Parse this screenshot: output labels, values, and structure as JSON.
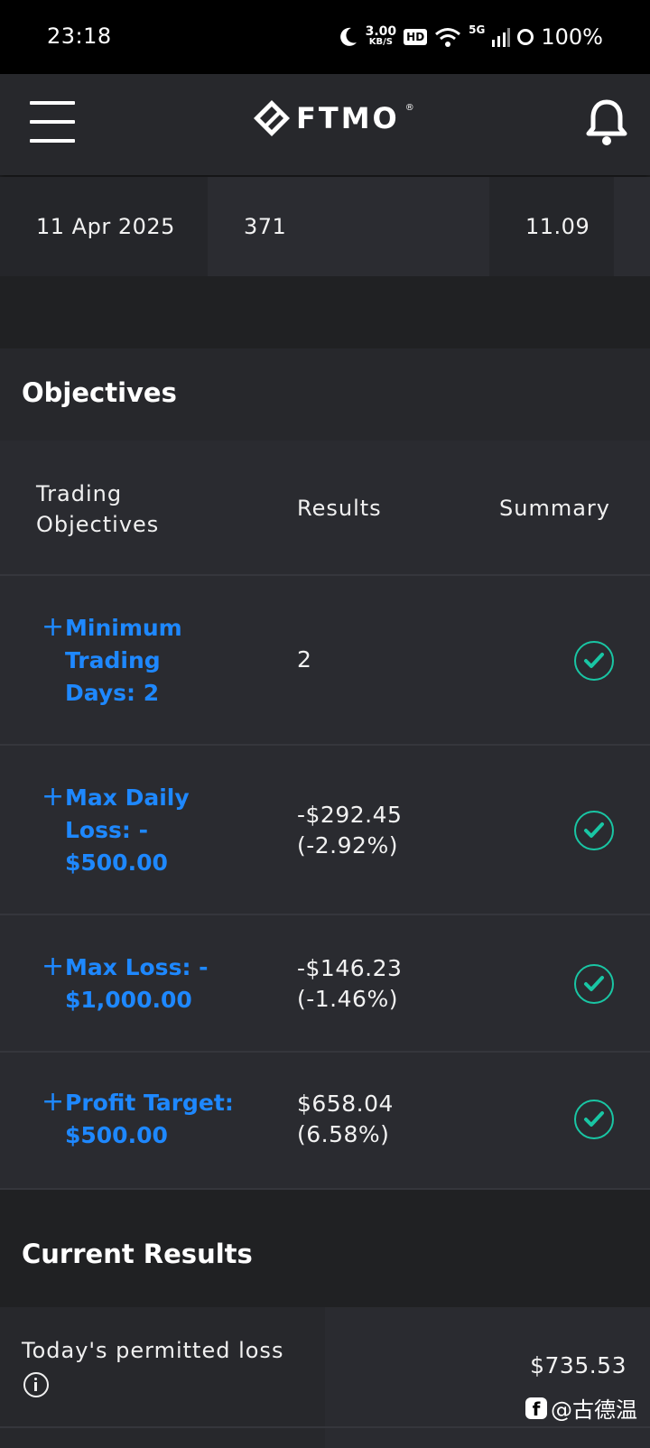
{
  "status_bar": {
    "time": "23:18",
    "net_speed": "3.00",
    "net_unit": "KB/S",
    "hd": "HD",
    "network": "5G",
    "battery": "100%"
  },
  "header": {
    "logo_text": "FTMO",
    "logo_reg": "®"
  },
  "previous_row": {
    "date": "11 Apr 2025",
    "col2": "371",
    "col3": "11.09"
  },
  "objectives": {
    "title": "Objectives",
    "headers": {
      "objective_line1": "Trading",
      "objective_line2": "Objectives",
      "results": "Results",
      "summary": "Summary"
    },
    "rows": [
      {
        "name_lines": [
          "Minimum",
          "Trading",
          "Days:  2"
        ],
        "result_lines": [
          "2"
        ],
        "status": "passed"
      },
      {
        "name_lines": [
          "Max Daily",
          "Loss:  -",
          "$500.00"
        ],
        "result_lines": [
          "-$292.45",
          "(-2.92%)"
        ],
        "status": "passed"
      },
      {
        "name_lines": [
          "Max Loss:  -",
          "$1,000.00"
        ],
        "result_lines": [
          "-$146.23",
          "(-1.46%)"
        ],
        "status": "passed"
      },
      {
        "name_lines": [
          "Profit Target:",
          "$500.00"
        ],
        "result_lines": [
          "$658.04",
          "(6.58%)"
        ],
        "status": "passed"
      }
    ]
  },
  "current_results": {
    "title": "Current Results",
    "rows": [
      {
        "label": "Today's permitted loss",
        "value": "$735.53"
      }
    ]
  },
  "watermark": {
    "text": "@古德温"
  },
  "colors": {
    "link_blue": "#1e88ff",
    "check_teal": "#19c6a4",
    "background": "#202123",
    "panel": "#2a2b30"
  }
}
